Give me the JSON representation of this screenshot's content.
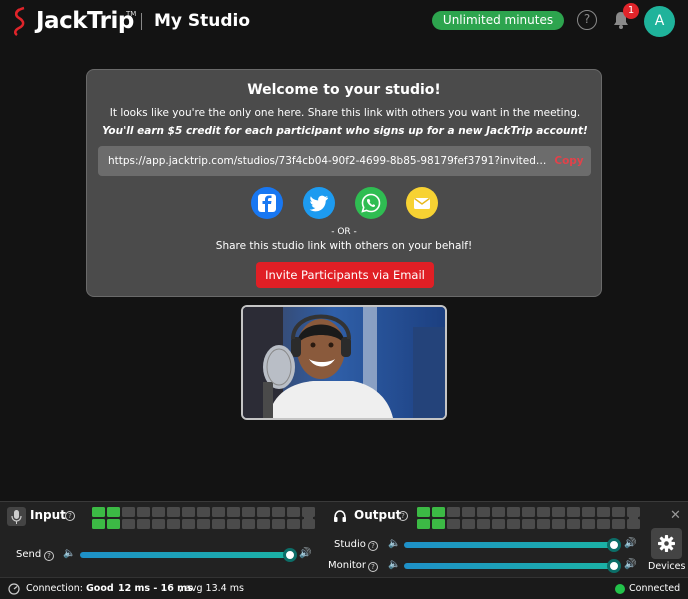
{
  "header": {
    "brand": "JackTrip",
    "brand_tm": "TM",
    "studio_title": "My Studio",
    "unlimited_label": "Unlimited minutes",
    "help_glyph": "?",
    "notification_count": "1",
    "avatar_initial": "A"
  },
  "welcome": {
    "title": "Welcome to your studio!",
    "description": "It looks like you're the only one here. Share this link with others you want in the meeting.",
    "description_bold": "You'll earn $5 credit for each participant who signs up for a new JackTrip account!",
    "link": "https://app.jacktrip.com/studios/73f4cb04-90f2-4699-8b85-98179fef3791?invited=t...",
    "copy_label": "Copy",
    "or_label": "- OR -",
    "share_behalf": "Share this studio link with others on your behalf!",
    "invite_label": "Invite Participants via Email",
    "share_icons": [
      "facebook-icon",
      "twitter-icon",
      "whatsapp-icon",
      "email-icon"
    ]
  },
  "panel": {
    "input_label": "Input",
    "output_label": "Output",
    "send_label": "Send",
    "studio_label": "Studio",
    "monitor_label": "Monitor",
    "devices_label": "Devices",
    "send_level": 1.0,
    "studio_level": 1.0,
    "monitor_level": 1.0,
    "input_meter_active": 2,
    "output_meter_active": 2
  },
  "status": {
    "connection_label": "Connection:",
    "quality": "Good",
    "latency": "12 ms - 16 ms",
    "avg": ", avg 13.4 ms",
    "connected": "Connected"
  },
  "colors": {
    "accent_red": "#e01f25",
    "success_green": "#2da44e",
    "avatar_teal": "#1fb39b",
    "quality_orange": "#f2b03a"
  }
}
